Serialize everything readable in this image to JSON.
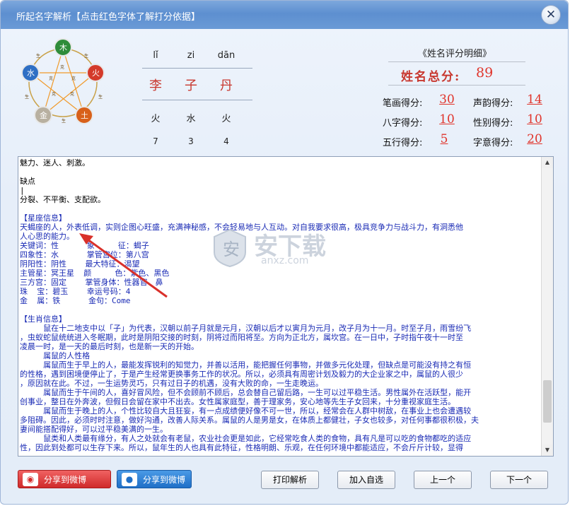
{
  "window": {
    "title": "所起名字解析【点击红色字体了解打分依据】"
  },
  "wuxing": {
    "nodes": [
      "木",
      "火",
      "土",
      "金",
      "水"
    ],
    "relations": [
      "生",
      "克"
    ]
  },
  "name": {
    "pinyin": [
      "lǐ",
      "zi",
      "dān"
    ],
    "chars": [
      "李",
      "子",
      "丹"
    ],
    "elements": [
      "火",
      "水",
      "火"
    ],
    "strokes": [
      "7",
      "3",
      "4"
    ]
  },
  "scores": {
    "title": "《姓名评分明细》",
    "total_label": "姓名总分:",
    "total_value": "89",
    "items": [
      {
        "label": "笔画得分:",
        "value": "30"
      },
      {
        "label": "声韵得分:",
        "value": "14"
      },
      {
        "label": "八字得分:",
        "value": "10"
      },
      {
        "label": "性别得分:",
        "value": "10"
      },
      {
        "label": "五行得分:",
        "value": "5"
      },
      {
        "label": "字意得分:",
        "value": "20"
      }
    ]
  },
  "analysis": {
    "lines": [
      {
        "text": "魅力、迷人、刺激。",
        "color": "black"
      },
      {
        "text": "",
        "color": "black"
      },
      {
        "text": "缺点",
        "color": "black"
      },
      {
        "text": "|",
        "color": "black"
      },
      {
        "text": "分裂、不平衡、支配欲。",
        "color": "black"
      },
      {
        "text": "",
        "color": "black"
      },
      {
        "text": "【星座信息】",
        "color": "blue"
      },
      {
        "text": "天蝎座的人，外表低调，实则企图心旺盛，充满神秘感，不会轻易地与人互动。对自我要求很高，极具竞争力与战斗力，有洞悉他",
        "color": "blue"
      },
      {
        "text": "人心思的能力。",
        "color": "blue"
      },
      {
        "text": "关键词：性      象     征：蝎子",
        "color": "blue"
      },
      {
        "text": "四象性：水      掌管宫位：第八宫",
        "color": "blue"
      },
      {
        "text": "阴阳性：阴性    最大特征：渴望",
        "color": "blue"
      },
      {
        "text": "主管星：冥王星  颜     色：紫色、黑色",
        "color": "blue"
      },
      {
        "text": "三方宫：固定    掌管身体：性器官、鼻",
        "color": "blue"
      },
      {
        "text": "珠  宝：碧玉    幸运号码：4",
        "color": "blue"
      },
      {
        "text": "金  属：铁      金句：Come",
        "color": "blue"
      },
      {
        "text": "",
        "color": "blue"
      },
      {
        "text": "【生肖信息】",
        "color": "blue"
      },
      {
        "text": "     鼠在十二地支中以「子」为代表，汉朝以前子月就是元月，汉朝以后才以寅月为元月，改子月为十一月。时至子月，雨雪纷飞",
        "color": "blue"
      },
      {
        "text": "，虫蚁蛇鼠统统进入冬眠期，此时是阴阳交接的时刻，阴将过而阳将至。方向为正北方，属坎宫。在一日中，子时指午夜十一时至",
        "color": "blue"
      },
      {
        "text": "凌晨一时，是一天的最后时刻，也是新一天的开始。",
        "color": "blue"
      },
      {
        "text": "     属鼠的人性格",
        "color": "blue"
      },
      {
        "text": "     属鼠而生于早上的人，最能发挥锐利的知觉力，并善以活用，能把握任何事物，并做多元化处理，但缺点是可能没有持之有恒",
        "color": "blue"
      },
      {
        "text": "的性格，遇到困境便停止了，于是产生经常更换事务工作的状况。所以，必须具有周密计划及毅力的大企业家之中，属鼠的人很少",
        "color": "blue"
      },
      {
        "text": "，原因就在此。不过，一生运势灵巧，只有过日子的机遇，没有大败的命，一生走晚运。",
        "color": "blue"
      },
      {
        "text": "     属鼠而生于午间的人，喜好冒风险，但不会顾前不顾后，总会替自己留后路，一生可以过平稳生活。男性属外在活跃型，能开",
        "color": "blue"
      },
      {
        "text": "创事业，整日在外奔波，但假日会留在家中不出去。女性属家庭型，善于理家务，安心地等先生子女回来，十分重视家庭生活。",
        "color": "blue"
      },
      {
        "text": "     属鼠而生于晚上的人，个性比较自大且狂妄，有一点成绩便好像不可一世，所以，经常会在人群中树敌，在事业上也会遭遇较",
        "color": "blue"
      },
      {
        "text": "多阻碍。因此，必须时时注意，做好沟通，改善人际关系。属鼠的人是男是女，在体质上都健壮，子女也较多，对任何事都很积极，夫",
        "color": "blue"
      },
      {
        "text": "妻间能搭配得好，可以过平稳美满的一生。",
        "color": "blue"
      },
      {
        "text": "     鼠类和人类最有缘分，有人之处就会有老鼠，农业社会更是如此，它经常吃食人类的食物，具有凡是可以吃的食物都吃的适应",
        "color": "blue"
      },
      {
        "text": "性，因此到处都可以生存下来。所以，鼠年生的人也具有此特征，性格明朗、乐观，在任何环境中都能适应，不会斤斤计较，显得",
        "color": "blue"
      }
    ]
  },
  "watermark": {
    "text": "安下载",
    "sub": "anxz.com"
  },
  "buttons": {
    "share_weibo": "分享到微博",
    "share_qq": "分享到微博",
    "print": "打印解析",
    "add_favorite": "加入自选",
    "prev": "上一个",
    "next": "下一个"
  },
  "colors": {
    "title_bar": "#6a9ad6",
    "score_red": "#e0342b",
    "text_blue": "#1a2bb5",
    "annotation_arrow": "#d9302a"
  }
}
